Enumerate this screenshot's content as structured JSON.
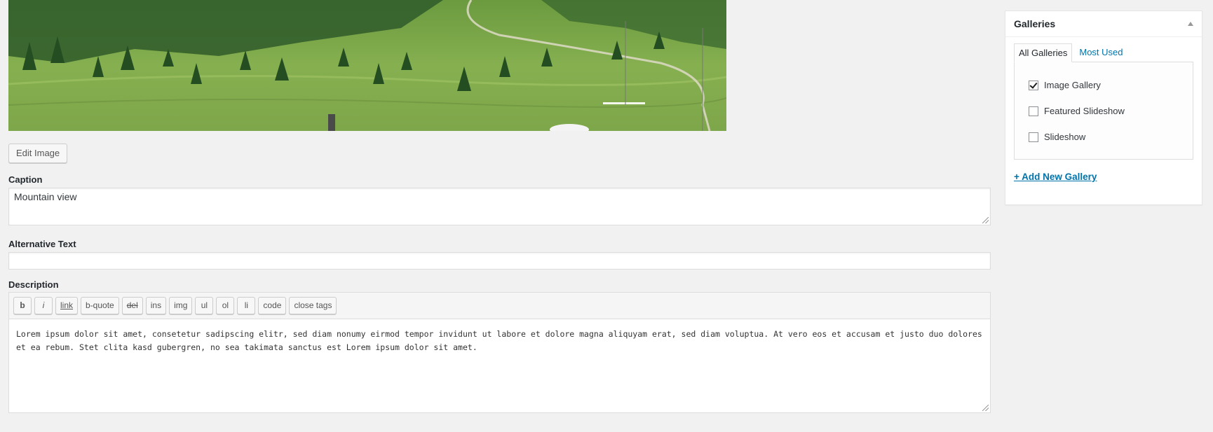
{
  "media": {
    "edit_image_label": "Edit Image"
  },
  "caption": {
    "label": "Caption",
    "value": "Mountain view"
  },
  "alt_text": {
    "label": "Alternative Text",
    "value": ""
  },
  "description": {
    "label": "Description",
    "quicktags": [
      "b",
      "i",
      "link",
      "b-quote",
      "del",
      "ins",
      "img",
      "ul",
      "ol",
      "li",
      "code",
      "close tags"
    ],
    "value": "Lorem ipsum dolor sit amet, consetetur sadipscing elitr, sed diam nonumy eirmod tempor invidunt ut labore et dolore magna aliquyam erat, sed diam voluptua. At vero eos et accusam et justo duo dolores et ea rebum. Stet clita kasd gubergren, no sea takimata sanctus est Lorem ipsum dolor sit amet."
  },
  "galleries": {
    "title": "Galleries",
    "tabs": [
      {
        "label": "All Galleries",
        "active": true
      },
      {
        "label": "Most Used",
        "active": false
      }
    ],
    "items": [
      {
        "label": "Image Gallery",
        "checked": true
      },
      {
        "label": "Featured Slideshow",
        "checked": false
      },
      {
        "label": "Slideshow",
        "checked": false
      }
    ],
    "add_new_label": "+ Add New Gallery"
  },
  "colors": {
    "background": "#f1f1f1",
    "link": "#0073aa",
    "border": "#dddddd"
  }
}
